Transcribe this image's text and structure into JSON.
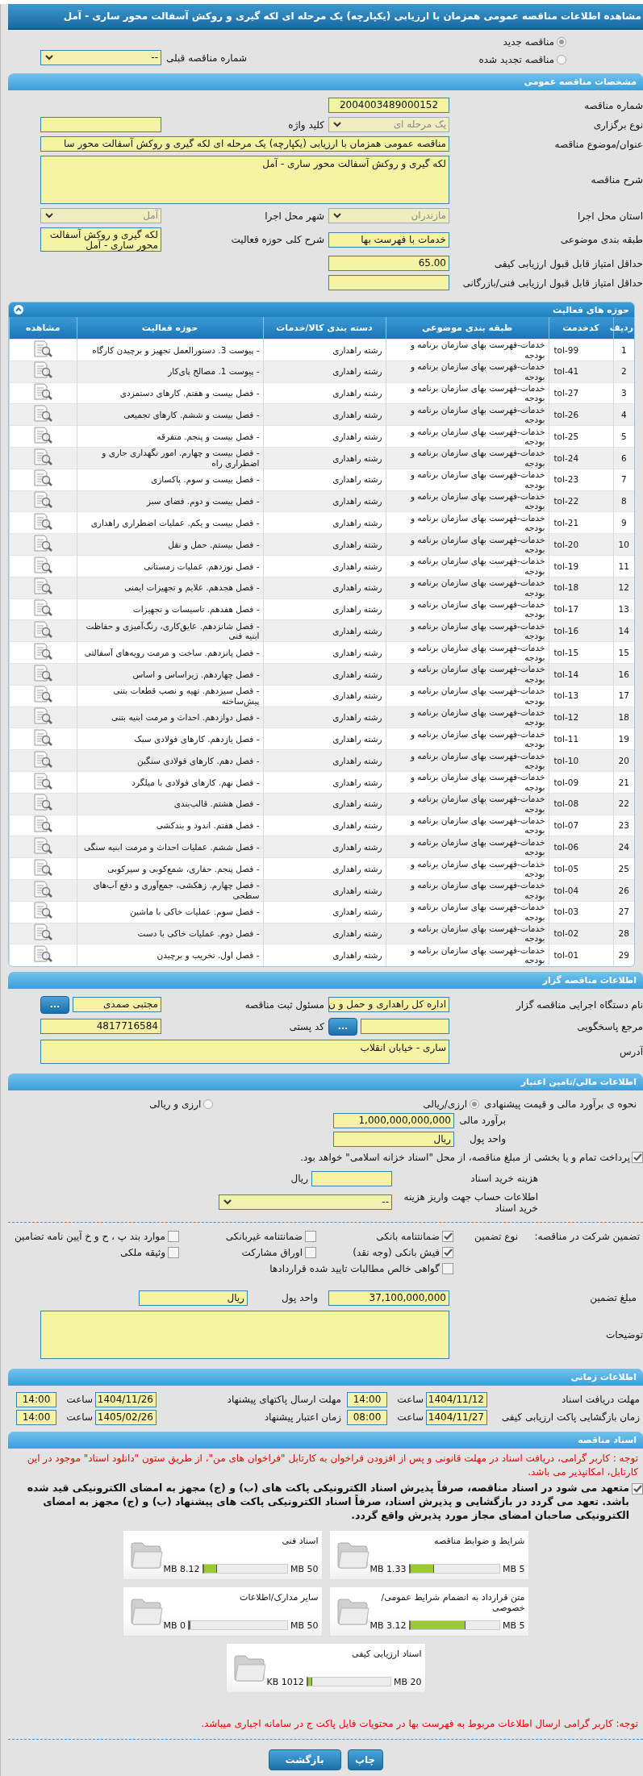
{
  "title": "مشاهده اطلاعات مناقصه عمومی همزمان با ارزیابی (یکپارچه) یک مرحله ای لکه گیری و روکش آسفالت محور ساری - آمل",
  "tender_type": [
    {
      "label": "مناقصه جدید",
      "selected": true
    },
    {
      "label": "مناقصه تجدید شده",
      "selected": false
    }
  ],
  "previous_tender": {
    "label": "شماره مناقصه قبلی",
    "kind": "select",
    "value": "--",
    "disabled": false
  },
  "general": {
    "header": "مشخصات مناقصه عمومی",
    "rows": [
      [
        {
          "label": "شماره مناقصه",
          "kind": "centered_text",
          "value": "2004003489000152"
        }
      ],
      [
        {
          "label": "نوع برگزاری",
          "kind": "select",
          "value": "یک مرحله ای",
          "disabled": true
        },
        {
          "label": "کلید واژه",
          "kind": "text"
        }
      ],
      [
        {
          "label": "عنوان/موضوع مناقصه",
          "kind": "wide_text",
          "value": "مناقصه عمومی همزمان با ارزیابی (یکپارچه) یک مرحله ای لکه گیری و روکش آسفالت محور سا"
        }
      ],
      [
        {
          "label": "شرح مناقصه",
          "kind": "wide_textarea",
          "value": "لکه گیری و روکش آسفالت محور ساری - آمل"
        }
      ],
      [
        {
          "label": "استان محل اجرا",
          "kind": "select",
          "value": "مازندران",
          "disabled": true
        },
        {
          "label": "شهر محل اجرا",
          "kind": "select",
          "value": "آمل",
          "disabled": true
        }
      ],
      [
        {
          "label": "طبقه بندی موضوعی",
          "kind": "text",
          "value": "خدمات با فهرست بها"
        },
        {
          "label": "شرح کلی حوزه فعالیت",
          "kind": "textarea",
          "value": "لکه گیری و روکش آسفالت محور ساری - آمل"
        }
      ],
      [
        {
          "label": "حداقل امتیاز قابل قبول ارزیابی کیفی",
          "kind": "text",
          "value": "65.00"
        }
      ],
      [
        {
          "label": "حداقل امتیاز قابل قبول ارزیابی فنی/بازرگانی",
          "kind": "text"
        }
      ]
    ]
  },
  "activities": {
    "title": "حوزه های فعالیت",
    "columns": [
      "ردیف",
      "کدخدمت",
      "طبقه بندی موضوعی",
      "دسته بندی کالا/خدمات",
      "حوزه فعالیت",
      "مشاهده"
    ],
    "rows": [
      [
        "1",
        "tol-99",
        "خدمات-فهرست بهای سازمان برنامه و بودجه",
        "رشته راهداری",
        "- پیوست 3. دستورالعمل تجهیز و برچیدن کارگاه"
      ],
      [
        "2",
        "tol-41",
        "خدمات-فهرست بهای سازمان برنامه و بودجه",
        "رشته راهداری",
        "- پیوست 1. مصالح پای‌کار"
      ],
      [
        "3",
        "tol-27",
        "خدمات-فهرست بهای سازمان برنامه و بودجه",
        "رشته راهداری",
        "- فصل بیست و هفتم. کارهای دستمزدی"
      ],
      [
        "4",
        "tol-26",
        "خدمات-فهرست بهای سازمان برنامه و بودجه",
        "رشته راهداری",
        "- فصل بیست و ششم. کارهای تجمیعی"
      ],
      [
        "5",
        "tol-25",
        "خدمات-فهرست بهای سازمان برنامه و بودجه",
        "رشته راهداری",
        "- فصل بیست و پنجم. متفرقه"
      ],
      [
        "6",
        "tol-24",
        "خدمات-فهرست بهای سازمان برنامه و بودجه",
        "رشته راهداری",
        "- فصل بیست و چهارم. امور نگهداری جاری و اضطراری راه"
      ],
      [
        "7",
        "tol-23",
        "خدمات-فهرست بهای سازمان برنامه و بودجه",
        "رشته راهداری",
        "- فصل بیست و سوم. پاکسازی"
      ],
      [
        "8",
        "tol-22",
        "خدمات-فهرست بهای سازمان برنامه و بودجه",
        "رشته راهداری",
        "- فصل بیست و دوم. فضای سبز"
      ],
      [
        "9",
        "tol-21",
        "خدمات-فهرست بهای سازمان برنامه و بودجه",
        "رشته راهداری",
        "- فصل بیست و یکم. عملیات اضطراری راهداری"
      ],
      [
        "10",
        "tol-20",
        "خدمات-فهرست بهای سازمان برنامه و بودجه",
        "رشته راهداری",
        "- فصل بیستم. حمل و نقل"
      ],
      [
        "11",
        "tol-19",
        "خدمات-فهرست بهای سازمان برنامه و بودجه",
        "رشته راهداری",
        "- فصل نوزدهم. عملیات زمستانی"
      ],
      [
        "12",
        "tol-18",
        "خدمات-فهرست بهای سازمان برنامه و بودجه",
        "رشته راهداری",
        "- فصل هجدهم. علایم و تجهیزات ایمنی"
      ],
      [
        "13",
        "tol-17",
        "خدمات-فهرست بهای سازمان برنامه و بودجه",
        "رشته راهداری",
        "- فصل هفدهم. تاسیسات و تجهیزات"
      ],
      [
        "14",
        "tol-16",
        "خدمات-فهرست بهای سازمان برنامه و بودجه",
        "رشته راهداری",
        "- فصل شانزدهم. عایق‌کاری، رنگ‌آمیزی و حفاظت ابنیه فنی"
      ],
      [
        "15",
        "tol-15",
        "خدمات-فهرست بهای سازمان برنامه و بودجه",
        "رشته راهداری",
        "- فصل پانزدهم. ساخت و مرمت رویه‌های آسفالتی"
      ],
      [
        "16",
        "tol-14",
        "خدمات-فهرست بهای سازمان برنامه و بودجه",
        "رشته راهداری",
        "- فصل چهاردهم. زیراساس و اساس"
      ],
      [
        "17",
        "tol-13",
        "خدمات-فهرست بهای سازمان برنامه و بودجه",
        "رشته راهداری",
        "- فصل سیزدهم. تهیه و نصب قطعات بتنی پیش‌ساخته"
      ],
      [
        "18",
        "tol-12",
        "خدمات-فهرست بهای سازمان برنامه و بودجه",
        "رشته راهداری",
        "- فصل دوازدهم. احداث و مرمت ابنیه بتنی"
      ],
      [
        "19",
        "tol-11",
        "خدمات-فهرست بهای سازمان برنامه و بودجه",
        "رشته راهداری",
        "- فصل یازدهم. کارهای فولادی سبک"
      ],
      [
        "20",
        "tol-10",
        "خدمات-فهرست بهای سازمان برنامه و بودجه",
        "رشته راهداری",
        "- فصل دهم. کارهای فولادی سنگین"
      ],
      [
        "21",
        "tol-09",
        "خدمات-فهرست بهای سازمان برنامه و بودجه",
        "رشته راهداری",
        "- فصل نهم. کارهای فولادی با میلگرد"
      ],
      [
        "22",
        "tol-08",
        "خدمات-فهرست بهای سازمان برنامه و بودجه",
        "رشته راهداری",
        "- فصل هشتم. قالب‌بندی"
      ],
      [
        "23",
        "tol-07",
        "خدمات-فهرست بهای سازمان برنامه و بودجه",
        "رشته راهداری",
        "- فصل هفتم. اندود و بندکشی"
      ],
      [
        "24",
        "tol-06",
        "خدمات-فهرست بهای سازمان برنامه و بودجه",
        "رشته راهداری",
        "- فصل ششم.  عملیات احداث و مرمت ابنیه سنگی"
      ],
      [
        "25",
        "tol-05",
        "خدمات-فهرست بهای سازمان برنامه و بودجه",
        "رشته راهداری",
        "- فصل پنجم. حفاری، شمع‌کوبی و سپرکوبی"
      ],
      [
        "26",
        "tol-04",
        "خدمات-فهرست بهای سازمان برنامه و بودجه",
        "رشته راهداری",
        "- فصل چهارم. زهکشی، جمع‌آوری و دفع آب‌های سطحی"
      ],
      [
        "27",
        "tol-03",
        "خدمات-فهرست بهای سازمان برنامه و بودجه",
        "رشته راهداری",
        "- فصل سوم. عملیات خاکی با ماشین"
      ],
      [
        "28",
        "tol-02",
        "خدمات-فهرست بهای سازمان برنامه و بودجه",
        "رشته راهداری",
        "- فصل دوم. عملیات خاکی با دست"
      ],
      [
        "29",
        "tol-01",
        "خدمات-فهرست بهای سازمان برنامه و بودجه",
        "رشته راهداری",
        "- فصل اول. تخریب و برچیدن"
      ]
    ]
  },
  "organizer": {
    "header": "اطلاعات مناقصه گزار",
    "rows": [
      [
        {
          "label": "نام دستگاه اجرایی مناقصه گزار",
          "kind": "text",
          "value": "اداره کل راهداری و حمل و ن"
        },
        {
          "label": "مسئول ثبت مناقصه",
          "kind": "text",
          "value": "مجتبی صمدی",
          "button": "..."
        }
      ],
      [
        {
          "label": "مرجع پاسخگویی",
          "kind": "text",
          "button": "..."
        },
        {
          "label": "کد پستی",
          "kind": "text",
          "value": "4817716584"
        }
      ],
      [
        {
          "label": "آدرس",
          "kind": "wide_small_textarea",
          "value": "ساری - خیابان  انقلاب"
        }
      ]
    ]
  },
  "finance": {
    "header": "اطلاعات مالی/تامین اعتبار",
    "estimate_method": {
      "label": "نحوه ی برآورد مالی و قیمت پیشنهادی",
      "options": [
        {
          "label": "ارزی/ریالی",
          "selected": true
        },
        {
          "label": "ارزی و ریالی",
          "selected": false
        }
      ]
    },
    "fields": [
      {
        "label": "برآورد مالی",
        "kind": "text",
        "value": "1,000,000,000,000"
      },
      {
        "label": "واحد پول",
        "kind": "text",
        "value": "ریال"
      }
    ],
    "treasury": {
      "text": "پرداخت تمام و یا بخشی از مبلغ مناقصه، از محل \"اسناد خزانه اسلامی\" خواهد بود.",
      "checked": true
    },
    "doc_fee": {
      "label": "هزینه خرید اسناد",
      "unit": "ریال"
    },
    "account": {
      "label": "اطلاعات حساب جهت واریز هزینه خرید اسناد",
      "kind": "select",
      "value": "--",
      "disabled": false
    },
    "guarantee": {
      "label": "تضمین شرکت در مناقصه:",
      "type_label": "نوع تضمین",
      "options": [
        {
          "label": "ضمانتنامه بانکی",
          "checked": true
        },
        {
          "label": "ضمانتنامه غیربانکی",
          "checked": false
        },
        {
          "label": "موارد بند پ ، ح و خ آیین نامه تضامین",
          "checked": false
        },
        {
          "label": "فیش بانکی (وجه نقد)",
          "checked": true
        },
        {
          "label": "اوراق مشارکت",
          "checked": false
        },
        {
          "label": "وثیقه ملکی",
          "checked": false
        },
        {
          "label": "گواهی خالص مطالبات تایید شده قراردادها",
          "checked": false
        }
      ]
    },
    "amount_row": [
      {
        "label": "مبلغ تضمین",
        "kind": "text",
        "value": "37,100,000,000"
      },
      {
        "label": "واحد پول",
        "kind": "text",
        "value": "ریال"
      }
    ],
    "notes": {
      "label": "توضیحات",
      "kind": "wide_textarea"
    }
  },
  "timing": {
    "header": "اطلاعات زمانی",
    "items": [
      {
        "label": "مهلت دریافت اسناد",
        "date": "1404/11/12",
        "time_label": "ساعت",
        "time": "14:00"
      },
      {
        "label": "مهلت ارسال پاکتهای پیشنهاد",
        "date": "1404/11/26",
        "time_label": "ساعت",
        "time": "14:00"
      },
      {
        "label": "زمان بازگشایی پاکت ارزیابی کیفی",
        "date": "1404/11/27",
        "time_label": "ساعت",
        "time": "08:00"
      },
      {
        "label": "زمان اعتبار پیشنهاد",
        "date": "1405/02/26",
        "time_label": "ساعت",
        "time": "14:00"
      }
    ]
  },
  "documents": {
    "header": "اسناد مناقصه",
    "note": "توجه : کاربر گرامی، دریافت اسناد در مهلت قانونی و پس از افزودن فراخوان به کارتابل \"فراخوان های من\"، از طریق ستون \"دانلود اسناد\" موجود در این کارتابل، امکانپذیر می باشد.",
    "commitment": {
      "text": "متعهد می شود در اسناد مناقصه، صرفاً پذیرش اسناد الکترونیکی پاکت های (ب) و (ج) مجهز به امضای الکترونیکی قید شده باشد. تعهد می گردد در بازگشایی و پذیرش اسناد، صرفاً اسناد الکترونیکی پاکت های پیشنهاد (ب) و (ج) مجهز به امضای الکترونیکی صاحبان امضای مجاز مورد پذیرش واقع گردد.",
      "checked": true
    },
    "files": [
      {
        "title": "شرایط و ضوابط مناقصه",
        "max": "5 MB",
        "used": "1.33 MB",
        "level": 0.27
      },
      {
        "title": "اسناد فنی",
        "max": "50 MB",
        "used": "8.12 MB",
        "level": 0.16
      },
      {
        "title": "متن قرارداد به انضمام شرایط عمومی/خصوصی",
        "max": "5 MB",
        "used": "3.12 MB",
        "level": 0.62
      },
      {
        "title": "سایر مدارک/اطلاعات",
        "max": "50 MB",
        "used": "0 MB",
        "level": 0
      },
      {
        "title": "اسناد ارزیابی کیفی",
        "max": "20 MB",
        "used": "1012 KB",
        "level": 0.05
      }
    ],
    "footer_note": "توجه: کاربر گرامی ارسال اطلاعات مربوط به فهرست بها در محتویات فایل پاکت ج در سامانه اجباری میباشد."
  },
  "buttons": [
    "چاپ",
    "بازگشت"
  ]
}
